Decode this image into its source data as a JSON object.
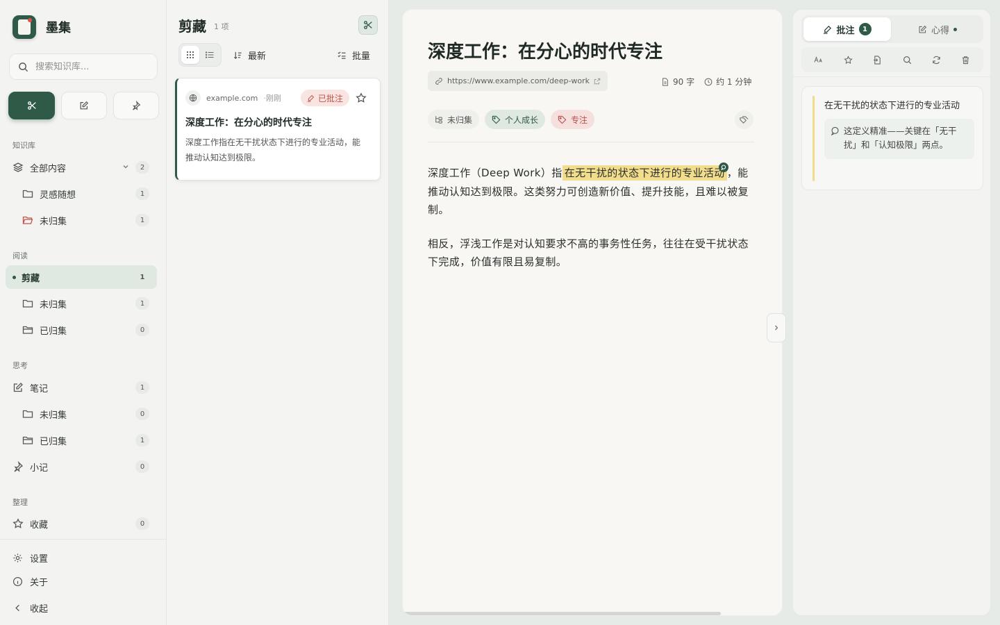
{
  "app": {
    "name": "墨集"
  },
  "colors": {
    "accent": "#2f5a48",
    "highlight": "#f2dd8c",
    "annotated_badge": "#c0554b"
  },
  "sidebar": {
    "search_placeholder": "搜索知识库...",
    "modes": [
      {
        "icon": "scissors-icon",
        "active": true
      },
      {
        "icon": "edit-icon",
        "active": false
      },
      {
        "icon": "pin-icon",
        "active": false
      }
    ],
    "sections": {
      "library": "知识库",
      "reading": "阅读",
      "thinking": "思考",
      "organize": "整理"
    },
    "library": {
      "all": {
        "label": "全部内容",
        "count": "2"
      },
      "inspiration": {
        "label": "灵感随想",
        "count": "1"
      },
      "unfiled": {
        "label": "未归集",
        "count": "1"
      }
    },
    "reading": {
      "clips": {
        "label": "剪藏",
        "count": "1"
      },
      "unfiled": {
        "label": "未归集",
        "count": "1"
      },
      "filed": {
        "label": "已归集",
        "count": "0"
      }
    },
    "thinking": {
      "notes": {
        "label": "笔记",
        "count": "1"
      },
      "unfiled": {
        "label": "未归集",
        "count": "0"
      },
      "filed": {
        "label": "已归集",
        "count": "1"
      },
      "memos": {
        "label": "小记",
        "count": "0"
      }
    },
    "organize": {
      "favorites": {
        "label": "收藏",
        "count": "0"
      }
    },
    "footer": {
      "settings": "设置",
      "about": "关于",
      "collapse": "收起"
    }
  },
  "list": {
    "title": "剪藏",
    "count": "1 项",
    "sort_label": "最新",
    "batch_label": "批量",
    "card": {
      "domain": "example.com",
      "time": "刚刚",
      "badge": "已批注",
      "title": "深度工作：在分心的时代专注",
      "excerpt": "深度工作指在无干扰状态下进行的专业活动，能推动认知达到极限。"
    }
  },
  "reader": {
    "title": "深度工作：在分心的时代专注",
    "url": "https://www.example.com/deep-work",
    "word_count": "90 字",
    "read_time": "约 1 分钟",
    "folder_tag": "未归集",
    "tags": [
      "个人成长",
      "专注"
    ],
    "para1_before": "深度工作（Deep Work）指",
    "para1_highlight": "在无干扰的状态下进行的专业活动",
    "para1_after": "，能推动认知达到极限。这类努力可创造新价值、提升技能，且难以被复制。",
    "para2": "相反，浮浅工作是对认知要求不高的事务性任务，往往在受干扰状态下完成，价值有限且易复制。"
  },
  "panel": {
    "tab_annotations": "批注",
    "annotation_count": "1",
    "tab_insights": "心得",
    "annotation": {
      "quote": "在无干扰的状态下进行的专业活动",
      "note": "这定义精准——关键在「无干扰」和「认知极限」两点。"
    }
  }
}
